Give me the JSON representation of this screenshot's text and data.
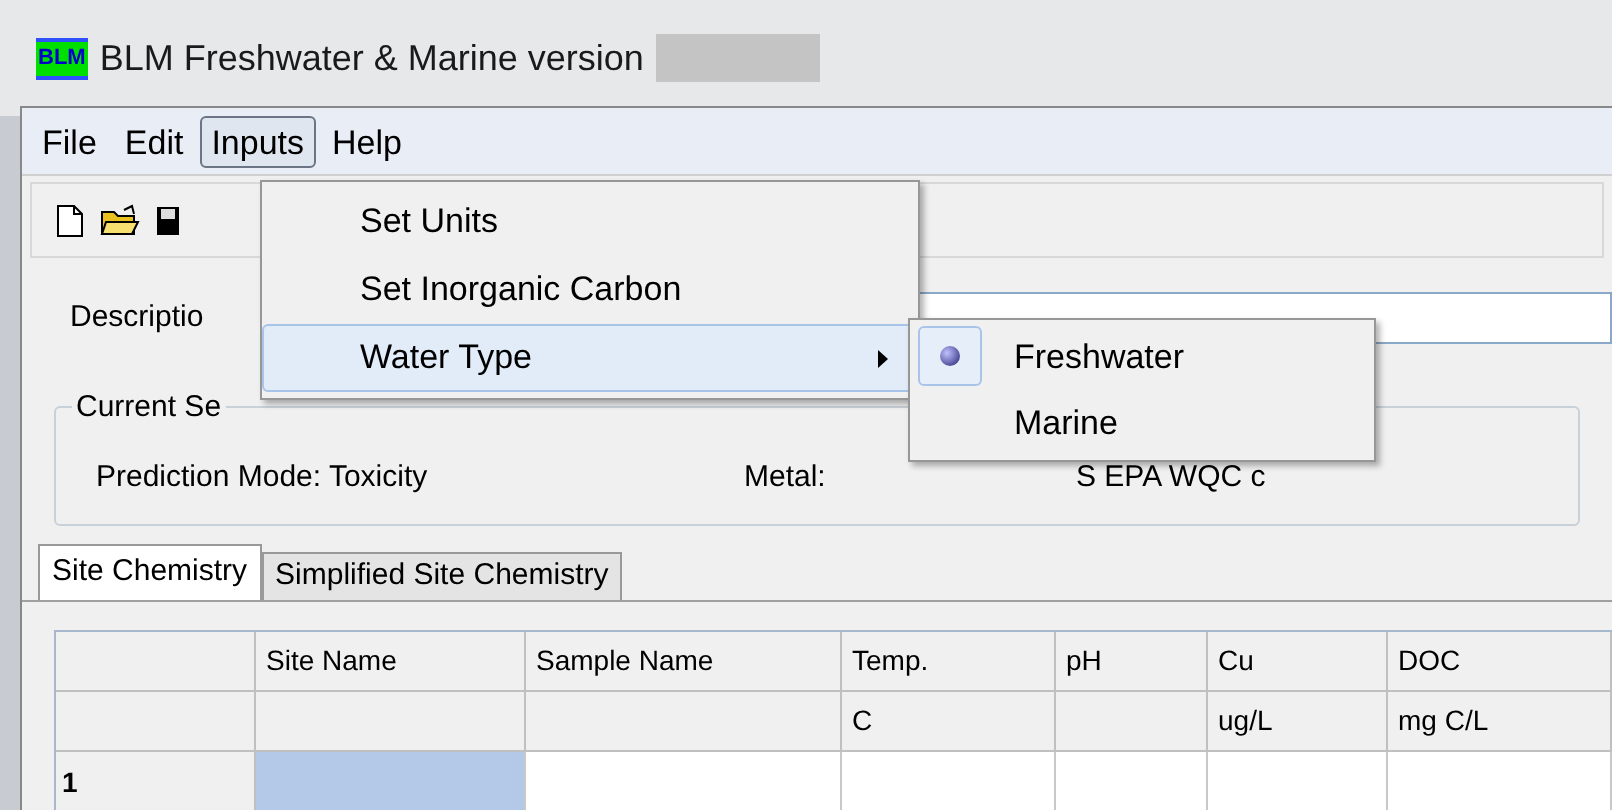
{
  "window": {
    "title": "BLM Freshwater & Marine version",
    "logo": "BLM"
  },
  "menu_bar": [
    {
      "label": "File",
      "selected": false
    },
    {
      "label": "Edit",
      "selected": false
    },
    {
      "label": "Inputs",
      "selected": true
    },
    {
      "label": "Help",
      "selected": false
    }
  ],
  "inputs_menu": [
    {
      "kind": "item",
      "label": "Set Units",
      "selected": false
    },
    {
      "kind": "item",
      "label": "Set Inorganic Carbon",
      "selected": false
    },
    {
      "kind": "submenu",
      "label": "Water Type",
      "selected": true
    }
  ],
  "water_type_submenu": [
    {
      "label": "Freshwater",
      "selected": true
    },
    {
      "label": "Marine",
      "selected": false
    }
  ],
  "description_label": "Descriptio",
  "current_selections": {
    "legend": "Current Se",
    "prediction_mode": "Prediction Mode: Toxicity",
    "metal": "Metal:",
    "organism": "S EPA WQC c"
  },
  "tabs": [
    {
      "label": "Site Chemistry",
      "selected": true
    },
    {
      "label": "Simplified Site Chemistry",
      "selected": false
    }
  ],
  "table": {
    "columns": [
      {
        "name": "Site Name"
      },
      {
        "name": "Sample Name"
      },
      {
        "name": "Temp.",
        "unit": "C"
      },
      {
        "name": "pH"
      },
      {
        "name": "Cu",
        "unit": "ug/L"
      },
      {
        "name": "DOC",
        "unit": "mg C/L"
      }
    ],
    "rows": [
      {
        "label": "1",
        "cells": [
          {
            "selected": true
          },
          {
            "selected": false
          },
          {
            "selected": false
          },
          {
            "selected": false
          },
          {
            "selected": false
          },
          {
            "selected": false
          }
        ]
      }
    ]
  }
}
